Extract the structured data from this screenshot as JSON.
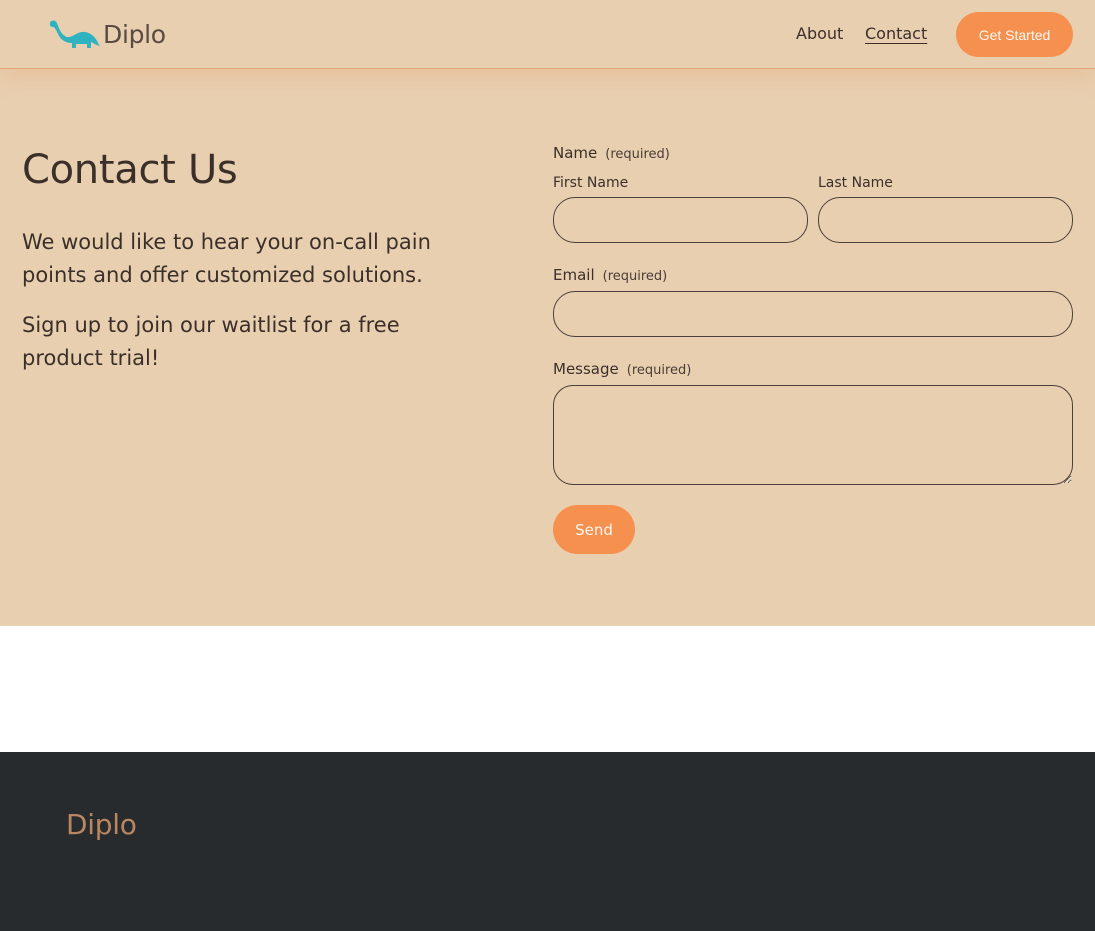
{
  "header": {
    "brand": "Diplo",
    "nav": {
      "about": "About",
      "contact": "Contact"
    },
    "cta": "Get Started",
    "logo_icon": "dinosaur-icon",
    "accent_color": "#f5904f",
    "logo_color": "#2fb3c0"
  },
  "contact": {
    "title": "Contact Us",
    "paragraph1": "We would like to hear your on-call pain points and offer customized solutions.",
    "paragraph2": "Sign up to join our waitlist for a free product trial!"
  },
  "form": {
    "name_label": "Name",
    "name_required": "(required)",
    "first_name_label": "First Name",
    "first_name_value": "",
    "last_name_label": "Last Name",
    "last_name_value": "",
    "email_label": "Email",
    "email_required": "(required)",
    "email_value": "",
    "message_label": "Message",
    "message_required": "(required)",
    "message_value": "",
    "submit_label": "Send"
  },
  "footer": {
    "brand": "Diplo"
  }
}
